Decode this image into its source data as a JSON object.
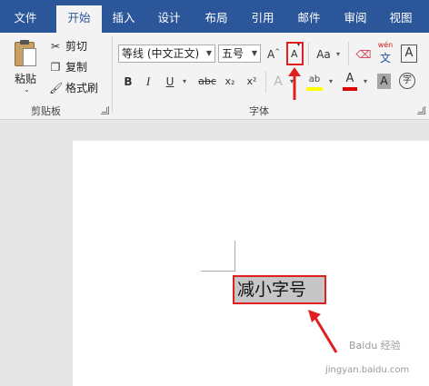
{
  "tabs": [
    {
      "label": "文件"
    },
    {
      "label": "开始"
    },
    {
      "label": "插入"
    },
    {
      "label": "设计"
    },
    {
      "label": "布局"
    },
    {
      "label": "引用"
    },
    {
      "label": "邮件"
    },
    {
      "label": "审阅"
    },
    {
      "label": "视图"
    }
  ],
  "clipboard": {
    "paste": "粘贴",
    "cut": "剪切",
    "copy": "复制",
    "format_painter": "格式刷",
    "group_label": "剪贴板"
  },
  "font": {
    "font_name": "等线 (中文正文)",
    "font_size": "五号",
    "grow": "A",
    "shrink": "A",
    "change_case": "Aa",
    "phonetic_top": "wén",
    "phonetic_bottom": "文",
    "border_char": "A",
    "bold": "B",
    "italic": "I",
    "underline": "U",
    "strikethrough": "abc",
    "subscript": "x₂",
    "superscript": "x²",
    "text_effects": "A",
    "highlight_label": "ab",
    "font_color_label": "A",
    "char_shading": "A",
    "enclose_char": "字",
    "group_label": "字体"
  },
  "document": {
    "selected_text": "减小字号"
  },
  "watermark": {
    "line1": "Baidu 经验",
    "line2": "jingyan.baidu.com"
  },
  "colors": {
    "ribbon_blue": "#2b579a",
    "annotation_red": "#e02020",
    "highlight_yellow": "#ffff00",
    "font_color_red": "#e00000"
  }
}
